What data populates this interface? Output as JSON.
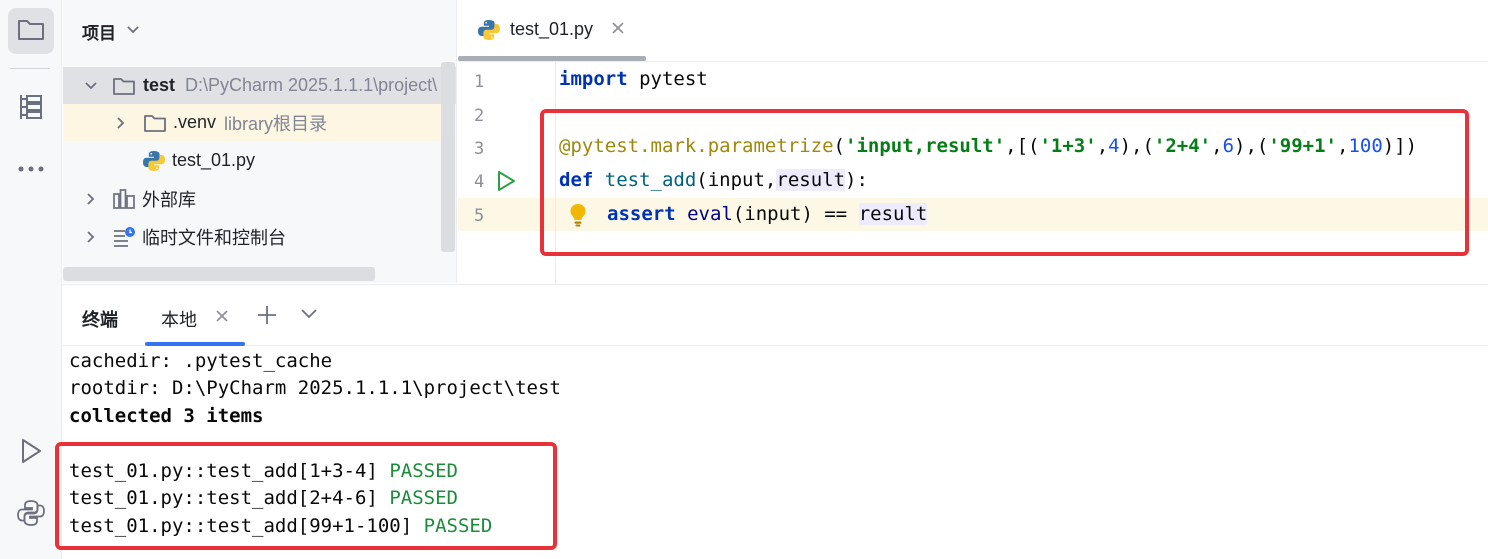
{
  "project_panel": {
    "title": "项目",
    "tree": [
      {
        "name": "test",
        "hint": "D:\\PyCharm 2025.1.1.1\\project\\"
      },
      {
        "name": ".venv",
        "hint": "library根目录"
      },
      {
        "name": "test_01.py"
      },
      {
        "name": "外部库"
      },
      {
        "name": "临时文件和控制台"
      }
    ]
  },
  "editor": {
    "tab": {
      "label": "test_01.py"
    },
    "line_numbers": [
      "1",
      "2",
      "3",
      "4",
      "5"
    ],
    "code": {
      "l1_kw": "import",
      "l1_rest": " pytest",
      "l3_deco": "@pytest.mark.parametrize",
      "l3_p1": "(",
      "l3_s1": "'input,result'",
      "l3_p2": ",[(",
      "l3_s2": "'1+3'",
      "l3_c1": ",",
      "l3_n1": "4",
      "l3_p3": "),(",
      "l3_s3": "'2+4'",
      "l3_c2": ",",
      "l3_n2": "6",
      "l3_p4": "),(",
      "l3_s4": "'99+1'",
      "l3_c3": ",",
      "l3_n3": "100",
      "l3_p5": ")])",
      "l4_kw": "def",
      "l4_sp": " ",
      "l4_fn": "test_add",
      "l4_p1": "(input,",
      "l4_hl": "result",
      "l4_p2": "):",
      "l5_kw": "assert",
      "l5_sp": " ",
      "l5_bi": "eval",
      "l5_mid": "(input) == ",
      "l5_hl": "result"
    }
  },
  "terminal": {
    "title": "终端",
    "tab_label": "本地",
    "lines": {
      "cachedir": "cachedir: .pytest_cache",
      "rootdir": "rootdir: D:\\PyCharm 2025.1.1.1\\project\\test",
      "collected": "collected 3 items",
      "t1": "test_01.py::test_add[1+3-4]",
      "t2": "test_01.py::test_add[2+4-6]",
      "t3": "test_01.py::test_add[99+1-100]",
      "status": "PASSED"
    }
  },
  "icons": {
    "activity_bar": [
      "folder-icon",
      "structure-icon",
      "more-icon",
      "run-icon",
      "python-console-icon"
    ],
    "project": [
      "chevron-down-icon",
      "folder-icon",
      "python-file-icon",
      "library-icon",
      "scratch-icon"
    ]
  },
  "colors": {
    "highlight_box": "#e8323a",
    "passed": "#1b8c3a",
    "keyword": "#0033b3",
    "string": "#067d17",
    "number": "#1750eb"
  }
}
